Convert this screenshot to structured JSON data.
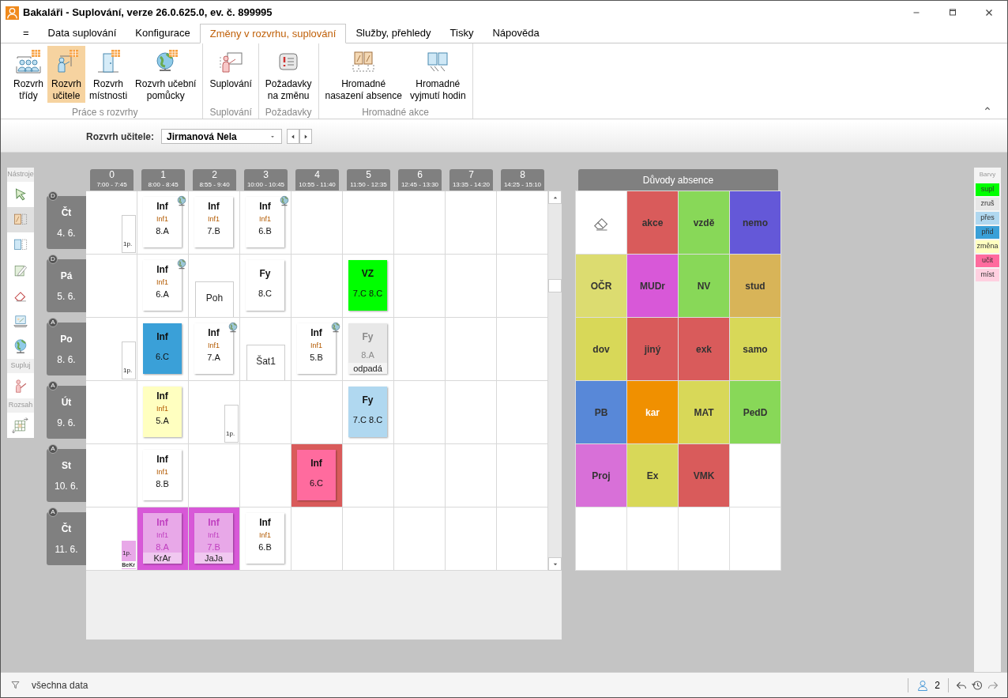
{
  "window": {
    "title": "Bakaláři - Suplování, verze 26.0.625.0, ev. č. 899995"
  },
  "tabs": [
    {
      "label": "=",
      "selected": false
    },
    {
      "label": "Data suplování",
      "selected": false
    },
    {
      "label": "Konfigurace",
      "selected": false
    },
    {
      "label": "Změny v rozvrhu, suplování",
      "selected": true
    },
    {
      "label": "Služby, přehledy",
      "selected": false
    },
    {
      "label": "Tisky",
      "selected": false
    },
    {
      "label": "Nápověda",
      "selected": false
    }
  ],
  "ribbon_groups": [
    {
      "label": "Práce s rozvrhy",
      "buttons": [
        {
          "label": "Rozvrh\ntřídy",
          "kind": "class",
          "selected": false
        },
        {
          "label": "Rozvrh\nučitele",
          "kind": "teacher",
          "selected": true
        },
        {
          "label": "Rozvrh\nmístnosti",
          "kind": "room",
          "selected": false
        },
        {
          "label": "Rozvrh učební\npomůcky",
          "kind": "aid",
          "selected": false
        }
      ]
    },
    {
      "label": "Suplování",
      "buttons": [
        {
          "label": "Suplování",
          "kind": "substitution",
          "selected": false
        }
      ]
    },
    {
      "label": "Požadavky",
      "buttons": [
        {
          "label": "Požadavky\nna změnu",
          "kind": "requests",
          "selected": false
        }
      ]
    },
    {
      "label": "Hromadné akce",
      "buttons": [
        {
          "label": "Hromadné\nnasazení absence",
          "kind": "mass-absence",
          "selected": false
        },
        {
          "label": "Hromadné\nvyjmutí hodin",
          "kind": "mass-removal",
          "selected": false
        }
      ]
    }
  ],
  "toolbar": {
    "label": "Rozvrh učitele:",
    "value": "Jirmanová Nela"
  },
  "tool_sections": [
    {
      "label": "Nástroje",
      "tools": [
        {
          "kind": "pointer",
          "selected": false
        },
        {
          "kind": "lesson",
          "selected": true
        },
        {
          "kind": "panel",
          "selected": false
        },
        {
          "kind": "edit",
          "selected": false
        },
        {
          "kind": "eraser",
          "selected": false
        },
        {
          "kind": "laptop",
          "selected": false
        },
        {
          "kind": "globe",
          "selected": false
        }
      ]
    },
    {
      "label": "Supluj",
      "tools": [
        {
          "kind": "teacher",
          "selected": false
        }
      ]
    },
    {
      "label": "Rozsah",
      "tools": [
        {
          "kind": "range",
          "selected": false
        }
      ]
    }
  ],
  "periods": [
    {
      "number": "0",
      "time": "7:00 - 7:45"
    },
    {
      "number": "1",
      "time": "8:00 - 8:45"
    },
    {
      "number": "2",
      "time": "8:55 - 9:40"
    },
    {
      "number": "3",
      "time": "10:00 - 10:45"
    },
    {
      "number": "4",
      "time": "10:55 - 11:40"
    },
    {
      "number": "5",
      "time": "11:50 - 12:35"
    },
    {
      "number": "6",
      "time": "12:45 - 13:30"
    },
    {
      "number": "7",
      "time": "13:35 - 14:20"
    },
    {
      "number": "8",
      "time": "14:25 - 15:10"
    }
  ],
  "days": [
    {
      "badge": "D",
      "day": "Čt",
      "date": "4. 6.",
      "slots": [
        {
          "kind": "empty",
          "marker": {
            "text": "1p."
          }
        },
        {
          "kind": "lesson",
          "subject": "Inf",
          "group": "Inf1",
          "class": "8.A",
          "globe": true,
          "color": "#ffffff"
        },
        {
          "kind": "lesson",
          "subject": "Inf",
          "group": "Inf1",
          "class": "7.B",
          "globe": false,
          "color": "#ffffff"
        },
        {
          "kind": "lesson",
          "subject": "Inf",
          "group": "Inf1",
          "class": "6.B",
          "globe": true,
          "color": "#ffffff"
        },
        {
          "kind": "empty"
        },
        {
          "kind": "empty"
        },
        {
          "kind": "empty"
        },
        {
          "kind": "empty"
        },
        {
          "kind": "empty"
        }
      ]
    },
    {
      "badge": "D",
      "day": "Pá",
      "date": "5. 6.",
      "slots": [
        {
          "kind": "empty"
        },
        {
          "kind": "lesson",
          "subject": "Inf",
          "group": "Inf1",
          "class": "6.A",
          "globe": true,
          "color": "#ffffff"
        },
        {
          "kind": "minor",
          "text": "Poh"
        },
        {
          "kind": "lesson",
          "subject": "Fy",
          "class": "8.C",
          "globe": false,
          "color": "#ffffff"
        },
        {
          "kind": "empty"
        },
        {
          "kind": "lesson",
          "subject": "VZ",
          "class": "7.C 8.C",
          "globe": false,
          "color": "#00ff00"
        },
        {
          "kind": "empty"
        },
        {
          "kind": "empty"
        },
        {
          "kind": "empty"
        }
      ]
    },
    {
      "badge": "A",
      "day": "Po",
      "date": "8. 6.",
      "slots": [
        {
          "kind": "empty",
          "marker": {
            "text": "1p."
          }
        },
        {
          "kind": "lesson",
          "subject": "Inf",
          "class": "6.C",
          "globe": false,
          "color": "#3aa0d8"
        },
        {
          "kind": "lesson",
          "subject": "Inf",
          "group": "Inf1",
          "class": "7.A",
          "globe": true,
          "color": "#ffffff"
        },
        {
          "kind": "minor",
          "text": "Šat1"
        },
        {
          "kind": "lesson",
          "subject": "Inf",
          "group": "Inf1",
          "class": "5.B",
          "globe": true,
          "color": "#ffffff"
        },
        {
          "kind": "cancelled",
          "subject": "Fy",
          "class": "8.A",
          "note": "odpadá",
          "color": "#e8e8e8"
        },
        {
          "kind": "empty"
        },
        {
          "kind": "empty"
        },
        {
          "kind": "empty"
        }
      ]
    },
    {
      "badge": "A",
      "day": "Út",
      "date": "9. 6.",
      "slots": [
        {
          "kind": "empty"
        },
        {
          "kind": "lesson",
          "subject": "Inf",
          "group": "Inf1",
          "class": "5.A",
          "globe": false,
          "color": "#ffffc0"
        },
        {
          "kind": "empty",
          "marker": {
            "text": "1p."
          }
        },
        {
          "kind": "empty"
        },
        {
          "kind": "empty"
        },
        {
          "kind": "lesson",
          "subject": "Fy",
          "class": "7.C 8.C",
          "globe": false,
          "color": "#b0d8f0"
        },
        {
          "kind": "empty"
        },
        {
          "kind": "empty"
        },
        {
          "kind": "empty"
        }
      ]
    },
    {
      "badge": "A",
      "day": "St",
      "date": "10. 6.",
      "slots": [
        {
          "kind": "empty"
        },
        {
          "kind": "lesson",
          "subject": "Inf",
          "group": "Inf1",
          "class": "8.B",
          "globe": false,
          "color": "#ffffff"
        },
        {
          "kind": "empty"
        },
        {
          "kind": "empty"
        },
        {
          "kind": "lesson",
          "subject": "Inf",
          "class": "6.C",
          "globe": false,
          "color": "#ff6b9e",
          "cell": {
            "color": "#d95b5b"
          }
        },
        {
          "kind": "empty"
        },
        {
          "kind": "empty"
        },
        {
          "kind": "empty"
        },
        {
          "kind": "empty"
        }
      ]
    },
    {
      "badge": "A",
      "day": "Čt",
      "date": "11. 6.",
      "slots": [
        {
          "kind": "empty",
          "marker": {
            "text": "1p.",
            "sub": "BeKr"
          }
        },
        {
          "kind": "absent",
          "subject": "Inf",
          "group": "Inf1",
          "class": "8.A",
          "note": "KrAr",
          "color": "#e8a8e8",
          "cell": {
            "color": "#d858d8"
          }
        },
        {
          "kind": "absent",
          "subject": "Inf",
          "group": "Inf1",
          "class": "7.B",
          "note": "JaJa",
          "color": "#e8a8e8",
          "cell": {
            "color": "#d858d8"
          }
        },
        {
          "kind": "lesson",
          "subject": "Inf",
          "group": "Inf1",
          "class": "6.B",
          "globe": false,
          "color": "#ffffff"
        },
        {
          "kind": "empty"
        },
        {
          "kind": "empty"
        },
        {
          "kind": "empty"
        },
        {
          "kind": "empty"
        },
        {
          "kind": "empty"
        }
      ]
    }
  ],
  "absence_panel": {
    "title": "Důvody absence",
    "reasons": [
      {
        "kind": "eraser"
      },
      {
        "kind": "reason",
        "label": "akce",
        "color": "#d95b5b"
      },
      {
        "kind": "reason",
        "label": "vzdě",
        "color": "#88d858"
      },
      {
        "kind": "reason",
        "label": "nemo",
        "color": "#6458d8"
      },
      {
        "kind": "reason",
        "label": "OČR",
        "color": "#dcdc70"
      },
      {
        "kind": "reason",
        "label": "MUDr",
        "color": "#d858d8"
      },
      {
        "kind": "reason",
        "label": "NV",
        "color": "#88d858"
      },
      {
        "kind": "reason",
        "label": "stud",
        "color": "#d8b458"
      },
      {
        "kind": "reason",
        "label": "dov",
        "color": "#d8d858"
      },
      {
        "kind": "reason",
        "label": "jiný",
        "color": "#d95b5b"
      },
      {
        "kind": "reason",
        "label": "exk",
        "color": "#d95b5b"
      },
      {
        "kind": "reason",
        "label": "samo",
        "color": "#d8d858"
      },
      {
        "kind": "reason",
        "label": "PB",
        "color": "#5888d8"
      },
      {
        "kind": "reason",
        "label": "kar",
        "color": "#f09000"
      },
      {
        "kind": "reason",
        "label": "MAT",
        "color": "#d8d858"
      },
      {
        "kind": "reason",
        "label": "PedD",
        "color": "#88d858"
      },
      {
        "kind": "reason",
        "label": "Proj",
        "color": "#d870d8"
      },
      {
        "kind": "reason",
        "label": "Ex",
        "color": "#d8d858"
      },
      {
        "kind": "reason",
        "label": "VMK",
        "color": "#d95b5b"
      }
    ]
  },
  "legend": {
    "title": "Barvy",
    "items": [
      {
        "label": "supl",
        "color": "#00ff00"
      },
      {
        "label": "zruš",
        "color": "#e8e8e8"
      },
      {
        "label": "přes",
        "color": "#b0d8f0"
      },
      {
        "label": "přid",
        "color": "#3aa0d8"
      },
      {
        "label": "změna",
        "color": "#ffffc0"
      },
      {
        "label": "učit",
        "color": "#ff6b9e"
      },
      {
        "label": "míst",
        "color": "#ffd0e0"
      }
    ]
  },
  "status_bar": {
    "filter": "všechna data",
    "users": "2"
  }
}
